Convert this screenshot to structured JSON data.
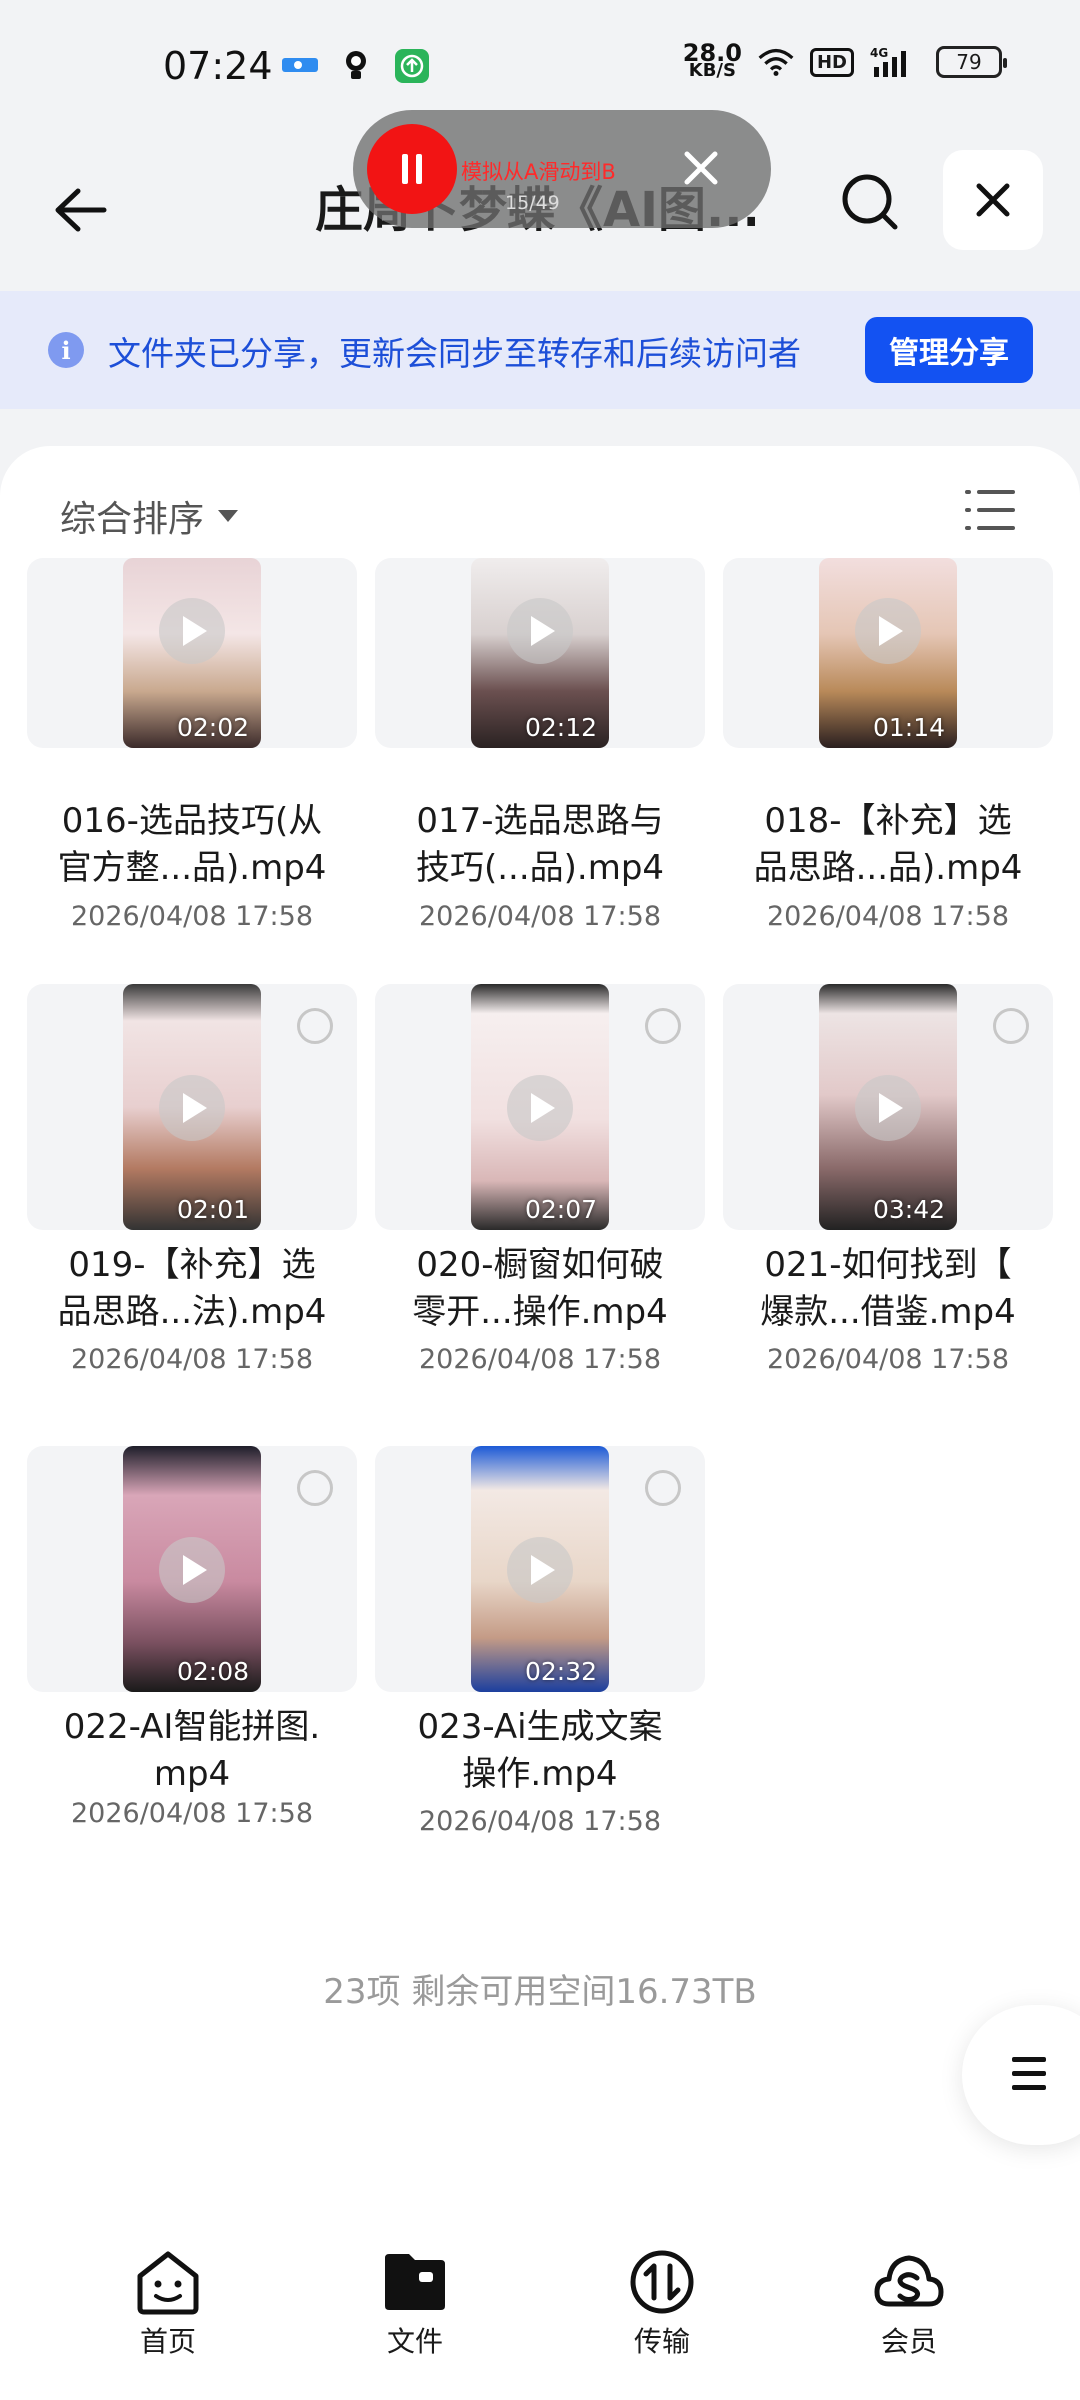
{
  "status_bar": {
    "time": "07:24",
    "net_speed_value": "28.0",
    "net_speed_unit": "KB/S",
    "hd": "HD",
    "signal": "4G",
    "battery": "79",
    "icons": [
      "location-tag-icon",
      "bulb-icon",
      "upload-app-icon",
      "wifi-icon",
      "signal-icon"
    ]
  },
  "header": {
    "title": "庄周卜梦蝶《AI图...",
    "back_icon": "back-arrow-icon",
    "search_icon": "search-icon",
    "close_icon": "close-icon"
  },
  "recording_overlay": {
    "label": "模拟从A滑动到B",
    "counter": "15/49"
  },
  "share_banner": {
    "text": "文件夹已分享，更新会同步至转存和后续访问者",
    "button": "管理分享"
  },
  "toolbar": {
    "sort_label": "综合排序"
  },
  "files": [
    {
      "name_line1": "016-选品技巧(从",
      "name_line2": "官方整...品).mp4",
      "date": "2026/04/08 17:58",
      "duration": "02:02"
    },
    {
      "name_line1": "017-选品思路与",
      "name_line2": "技巧(...品).mp4",
      "date": "2026/04/08 17:58",
      "duration": "02:12"
    },
    {
      "name_line1": "018-【补充】选",
      "name_line2": "品思路...品).mp4",
      "date": "2026/04/08 17:58",
      "duration": "01:14"
    },
    {
      "name_line1": "019-【补充】选",
      "name_line2": "品思路...法).mp4",
      "date": "2026/04/08 17:58",
      "duration": "02:01"
    },
    {
      "name_line1": "020-橱窗如何破",
      "name_line2": "零开...操作.mp4",
      "date": "2026/04/08 17:58",
      "duration": "02:07"
    },
    {
      "name_line1": "021-如何找到【",
      "name_line2": "爆款...借鉴.mp4",
      "date": "2026/04/08 17:58",
      "duration": "03:42"
    },
    {
      "name_line1": "022-AI智能拼图.",
      "name_line2": "mp4",
      "date": "2026/04/08 17:58",
      "duration": "02:08"
    },
    {
      "name_line1": "023-Ai生成文案",
      "name_line2": "操作.mp4",
      "date": "2026/04/08 17:58",
      "duration": "02:32"
    }
  ],
  "footer": {
    "info": "23项 剩余可用空间16.73TB"
  },
  "bottom_nav": [
    {
      "label": "首页",
      "icon": "home-face-icon"
    },
    {
      "label": "文件",
      "icon": "folder-icon"
    },
    {
      "label": "传输",
      "icon": "transfer-icon"
    },
    {
      "label": "会员",
      "icon": "vip-cloud-icon"
    }
  ],
  "colors": {
    "accent": "#1352f2",
    "banner_bg": "#e6eafa",
    "record_red": "#f21414"
  }
}
